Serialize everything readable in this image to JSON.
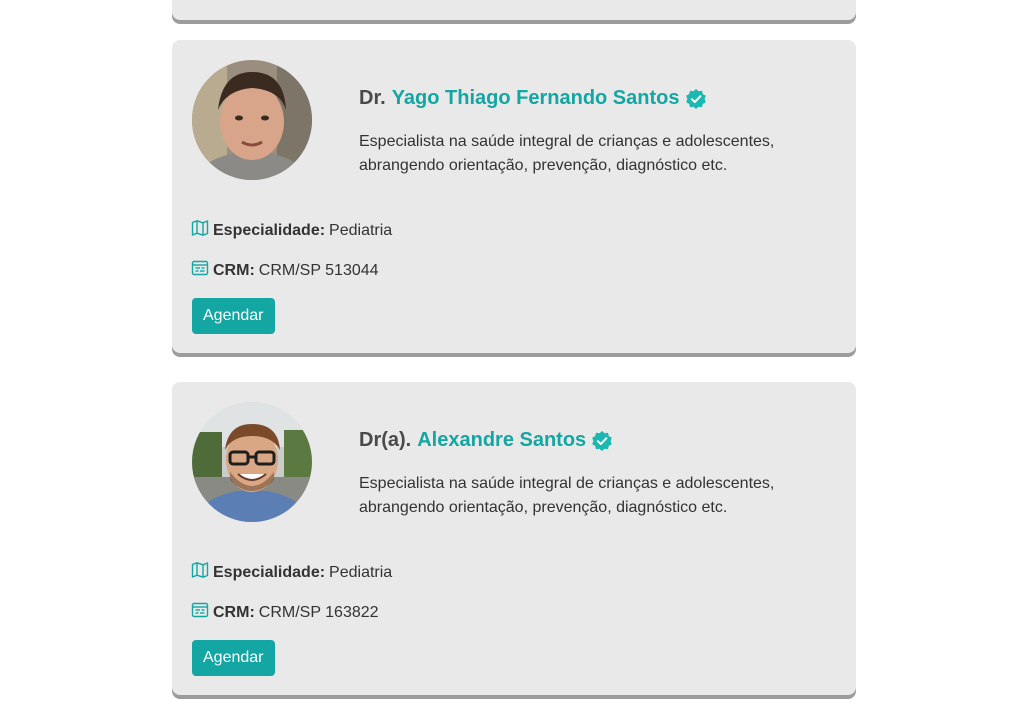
{
  "colors": {
    "accent": "#14a6a2",
    "card_background": "#e9e9e9",
    "verified": "#1ab8b0"
  },
  "doctors": [
    {
      "title": "Dr.",
      "name": "Yago Thiago Fernando Santos",
      "description": "Especialista na saúde integral de crianças e adolescentes, abrangendo orientação, prevenção, diagnóstico etc.",
      "specialty_label": "Especialidade:",
      "specialty": "Pediatria",
      "crm_label": "CRM:",
      "crm": "CRM/SP 513044",
      "button_label": "Agendar",
      "avatar_icon": "doctor-photo",
      "specialty_icon": "map-icon",
      "crm_icon": "id-card-icon",
      "verified_icon": "verified-badge-icon"
    },
    {
      "title": "Dr(a).",
      "name": "Alexandre Santos",
      "description": "Especialista na saúde integral de crianças e adolescentes, abrangendo orientação, prevenção, diagnóstico etc.",
      "specialty_label": "Especialidade:",
      "specialty": "Pediatria",
      "crm_label": "CRM:",
      "crm": "CRM/SP 163822",
      "button_label": "Agendar",
      "avatar_icon": "doctor-photo",
      "specialty_icon": "map-icon",
      "crm_icon": "id-card-icon",
      "verified_icon": "verified-badge-icon"
    }
  ]
}
